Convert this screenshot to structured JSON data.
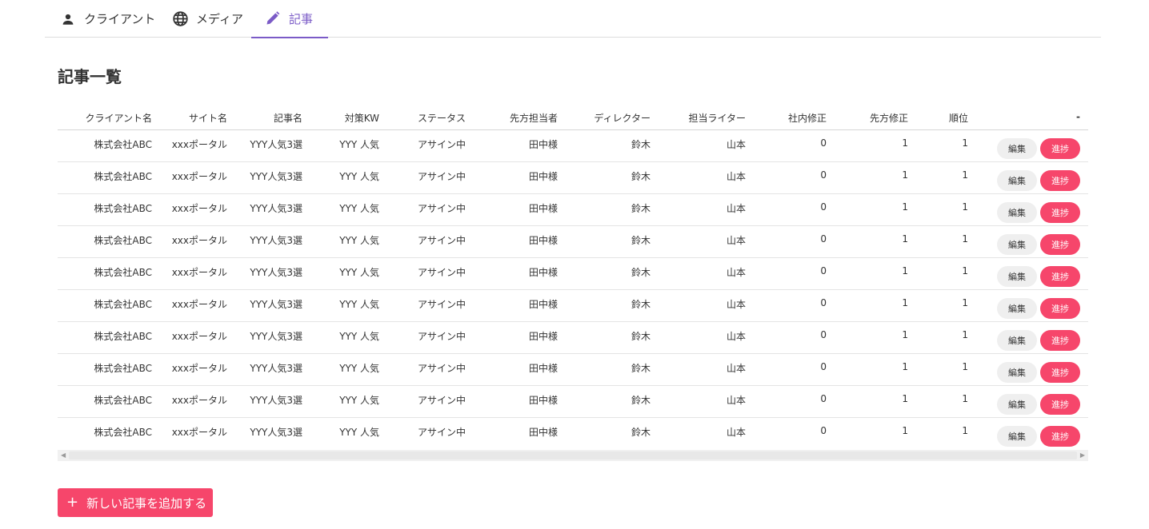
{
  "tabs": [
    {
      "label": "クライアント",
      "icon": "person-icon"
    },
    {
      "label": "メディア",
      "icon": "globe-icon"
    },
    {
      "label": "記事",
      "icon": "pencil-icon",
      "active": true
    }
  ],
  "colors": {
    "accent": "#7b5bc7",
    "primary": "#f6466b",
    "edit_bg": "#efefef"
  },
  "page_title": "記事一覧",
  "table": {
    "headers": [
      "クライアント名",
      "サイト名",
      "記事名",
      "対策KW",
      "ステータス",
      "先方担当者",
      "ディレクター",
      "担当ライター",
      "社内修正",
      "先方修正",
      "順位",
      "-"
    ],
    "rows": [
      [
        "株式会社ABC",
        "xxxポータル",
        "YYY人気3選",
        "YYY 人気",
        "アサイン中",
        "田中様",
        "鈴木",
        "山本",
        "0",
        "1",
        "1"
      ],
      [
        "株式会社ABC",
        "xxxポータル",
        "YYY人気3選",
        "YYY 人気",
        "アサイン中",
        "田中様",
        "鈴木",
        "山本",
        "0",
        "1",
        "1"
      ],
      [
        "株式会社ABC",
        "xxxポータル",
        "YYY人気3選",
        "YYY 人気",
        "アサイン中",
        "田中様",
        "鈴木",
        "山本",
        "0",
        "1",
        "1"
      ],
      [
        "株式会社ABC",
        "xxxポータル",
        "YYY人気3選",
        "YYY 人気",
        "アサイン中",
        "田中様",
        "鈴木",
        "山本",
        "0",
        "1",
        "1"
      ],
      [
        "株式会社ABC",
        "xxxポータル",
        "YYY人気3選",
        "YYY 人気",
        "アサイン中",
        "田中様",
        "鈴木",
        "山本",
        "0",
        "1",
        "1"
      ],
      [
        "株式会社ABC",
        "xxxポータル",
        "YYY人気3選",
        "YYY 人気",
        "アサイン中",
        "田中様",
        "鈴木",
        "山本",
        "0",
        "1",
        "1"
      ],
      [
        "株式会社ABC",
        "xxxポータル",
        "YYY人気3選",
        "YYY 人気",
        "アサイン中",
        "田中様",
        "鈴木",
        "山本",
        "0",
        "1",
        "1"
      ],
      [
        "株式会社ABC",
        "xxxポータル",
        "YYY人気3選",
        "YYY 人気",
        "アサイン中",
        "田中様",
        "鈴木",
        "山本",
        "0",
        "1",
        "1"
      ],
      [
        "株式会社ABC",
        "xxxポータル",
        "YYY人気3選",
        "YYY 人気",
        "アサイン中",
        "田中様",
        "鈴木",
        "山本",
        "0",
        "1",
        "1"
      ],
      [
        "株式会社ABC",
        "xxxポータル",
        "YYY人気3選",
        "YYY 人気",
        "アサイン中",
        "田中様",
        "鈴木",
        "山本",
        "0",
        "1",
        "1"
      ]
    ],
    "edit_label": "編集",
    "progress_label": "進捗"
  },
  "add_button": {
    "label": "新しい記事を追加する",
    "icon": "plus-icon"
  }
}
